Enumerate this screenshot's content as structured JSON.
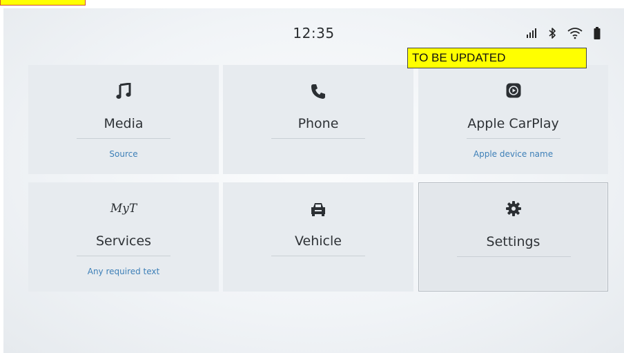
{
  "corner_tag": "",
  "status_bar": {
    "time": "12:35",
    "icons": [
      "signal-icon",
      "bluetooth-icon",
      "wifi-icon",
      "battery-icon"
    ]
  },
  "banner": {
    "text": "TO BE UPDATED",
    "color": "#ffff00"
  },
  "tiles": [
    {
      "title": "Media",
      "subtitle": "Source",
      "icon": "music-note-icon"
    },
    {
      "title": "Phone",
      "subtitle": "",
      "icon": "phone-icon"
    },
    {
      "title": "Apple CarPlay",
      "subtitle": "Apple device name",
      "icon": "carplay-icon"
    },
    {
      "title": "Services",
      "subtitle": "Any required text",
      "icon": "myt-logo",
      "logo_text": "MyT"
    },
    {
      "title": "Vehicle",
      "subtitle": "",
      "icon": "car-icon"
    },
    {
      "title": "Settings",
      "subtitle": "",
      "icon": "gear-icon",
      "selected": true
    }
  ],
  "colors": {
    "subtitle": "#3d7fb7",
    "tile_bg": "#e7ebef",
    "text": "#2e3236"
  }
}
